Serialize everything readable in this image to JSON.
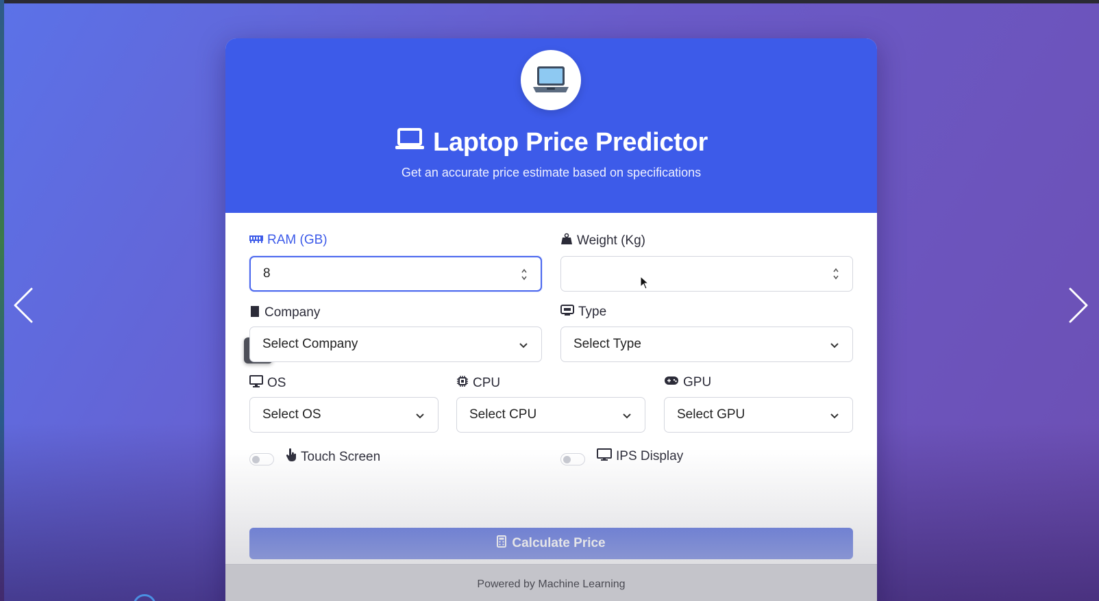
{
  "header": {
    "title": "Laptop Price Predictor",
    "subtitle": "Get an accurate price estimate based on specifications"
  },
  "form": {
    "ram": {
      "label": "RAM (GB)",
      "value": "8",
      "tooltip": "8"
    },
    "weight": {
      "label": "Weight (Kg)",
      "value": ""
    },
    "company": {
      "label": "Company",
      "value": "Select Company"
    },
    "type": {
      "label": "Type",
      "value": "Select Type"
    },
    "os": {
      "label": "OS",
      "value": "Select OS"
    },
    "cpu": {
      "label": "CPU",
      "value": "Select CPU"
    },
    "gpu": {
      "label": "GPU",
      "value": "Select GPU"
    },
    "touch": {
      "label": "Touch Screen",
      "checked": false
    },
    "ips": {
      "label": "IPS Display",
      "checked": false
    }
  },
  "actions": {
    "calculate": "Calculate Price"
  },
  "footer": {
    "text": "Powered by Machine Learning"
  },
  "colors": {
    "accent": "#3d5be9",
    "button": "#3450d6",
    "active_label": "#3d5be9"
  },
  "icons": {
    "logo": "laptop-icon",
    "title": "laptop-outline-icon",
    "ram": "memory-icon",
    "weight": "weight-icon",
    "company": "building-icon",
    "type": "keyboard-icon",
    "os": "desktop-icon",
    "cpu": "microchip-icon",
    "gpu": "gamepad-icon",
    "touch": "hand-pointer-icon",
    "ips": "monitor-icon",
    "calculate": "calculator-icon"
  }
}
